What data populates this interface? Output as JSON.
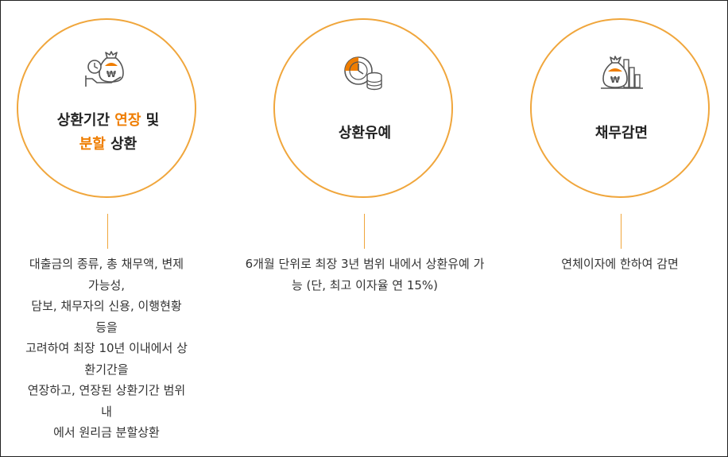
{
  "colors": {
    "accent": "#ef7d00",
    "circle_border": "#f0a63c",
    "text": "#333333",
    "icon_dark": "#555555"
  },
  "items": [
    {
      "icon": "money-bag-clock-hand-icon",
      "title_parts": [
        "상환기간 ",
        "연장",
        " 및",
        "분할",
        " 상환"
      ],
      "description_lines": [
        "대출금의 종류, 총 채무액, 변제",
        "가능성,",
        "담보, 채무자의 신용, 이행현황",
        "등을",
        "고려하여 최장 10년 이내에서 상",
        "환기간을",
        "연장하고, 연장된 상환기간 범위",
        "내",
        "에서 원리금 분할상환"
      ]
    },
    {
      "icon": "clock-coins-icon",
      "title": "상환유예",
      "description_lines": [
        "6개월 단위로 최장 3년 범위 내에서 상환유예 가",
        "능 (단, 최고 이자율 연 15%)"
      ]
    },
    {
      "icon": "money-bag-bar-chart-icon",
      "title": "채무감면",
      "description_lines": [
        "연체이자에 한하여 감면"
      ]
    }
  ]
}
